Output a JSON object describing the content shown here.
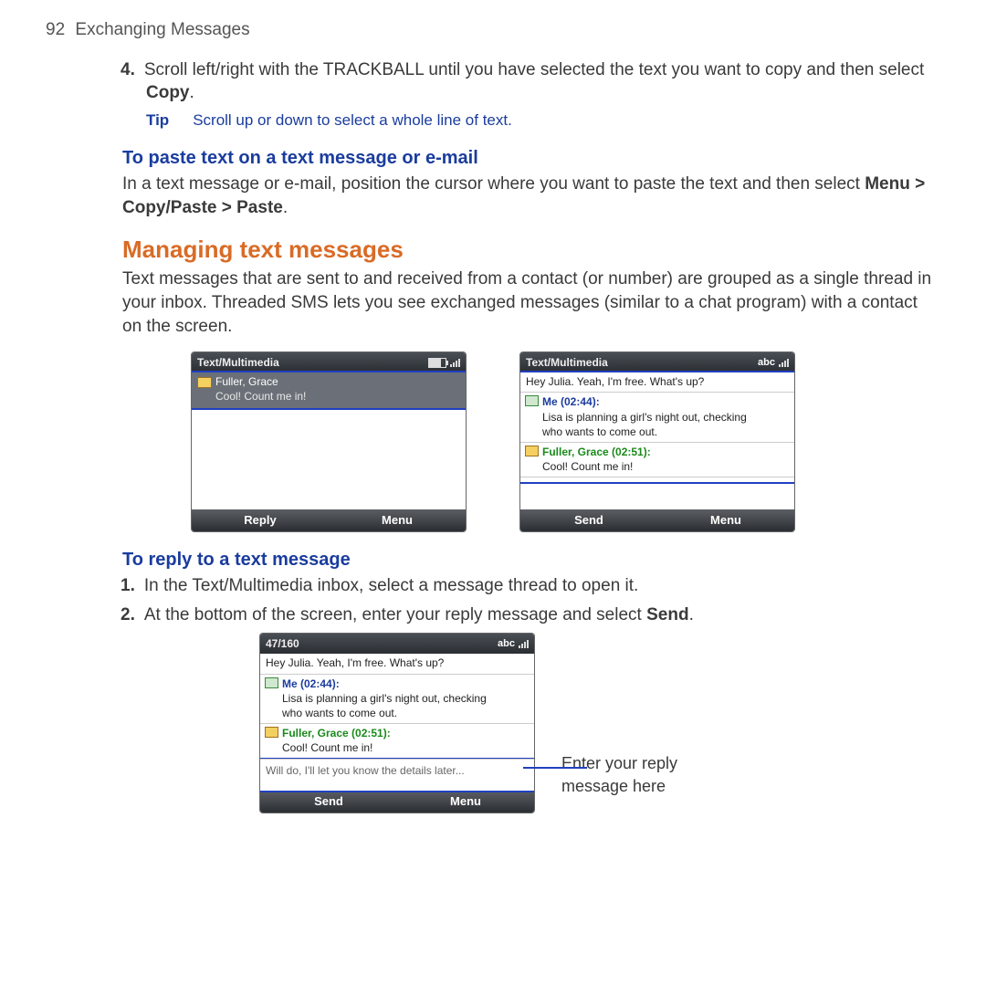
{
  "header": {
    "page_number": "92",
    "section": "Exchanging Messages"
  },
  "step4": {
    "num": "4.",
    "text_a": "Scroll left/right with the TRACKBALL until you have selected the text you want to copy and then select ",
    "text_b": "Copy",
    "text_c": "."
  },
  "tip": {
    "label": "Tip",
    "text": "Scroll up or down to select a whole line of text."
  },
  "paste_heading": "To paste text on a text message or e-mail",
  "paste_body_a": "In a text message or e-mail, position the cursor where you want to paste the text and then select ",
  "paste_body_b": "Menu > Copy/Paste > Paste",
  "paste_body_c": ".",
  "managing_heading": "Managing text messages",
  "managing_body": "Text messages that are sent to and received from a contact (or number) are grouped as a single thread in your inbox. Threaded SMS lets you see exchanged messages (similar to a chat program) with a contact on the screen.",
  "screen1": {
    "title": "Text/Multimedia",
    "thread_from": "Fuller, Grace",
    "thread_preview": "Cool! Count me in!",
    "soft_left": "Reply",
    "soft_right": "Menu"
  },
  "screen2": {
    "title": "Text/Multimedia",
    "indicator": "abc",
    "msg1": "Hey Julia. Yeah, I'm free. What's up?",
    "me_label": "Me (02:44):",
    "msg2a": "Lisa is planning a girl's night out, checking",
    "msg2b": "who wants to come out.",
    "from_label": "Fuller, Grace (02:51):",
    "msg3": "Cool! Count me in!",
    "soft_left": "Send",
    "soft_right": "Menu"
  },
  "reply_heading": "To reply to a text message",
  "reply_step1": {
    "num": "1.",
    "text": "In the Text/Multimedia inbox, select a message thread to open it."
  },
  "reply_step2": {
    "num": "2.",
    "text_a": "At the bottom of the screen, enter your reply message and select ",
    "text_b": "Send",
    "text_c": "."
  },
  "screen3": {
    "title": "47/160",
    "indicator": "abc",
    "msg1": "Hey Julia. Yeah, I'm free. What's up?",
    "me_label": "Me (02:44):",
    "msg2a": "Lisa is planning a girl's night out, checking",
    "msg2b": "who wants to come out.",
    "from_label": "Fuller, Grace (02:51):",
    "msg3": "Cool! Count me in!",
    "reply_text": "Will do, I'll let you know the details later...",
    "soft_left": "Send",
    "soft_right": "Menu"
  },
  "callout": "Enter your reply message here"
}
